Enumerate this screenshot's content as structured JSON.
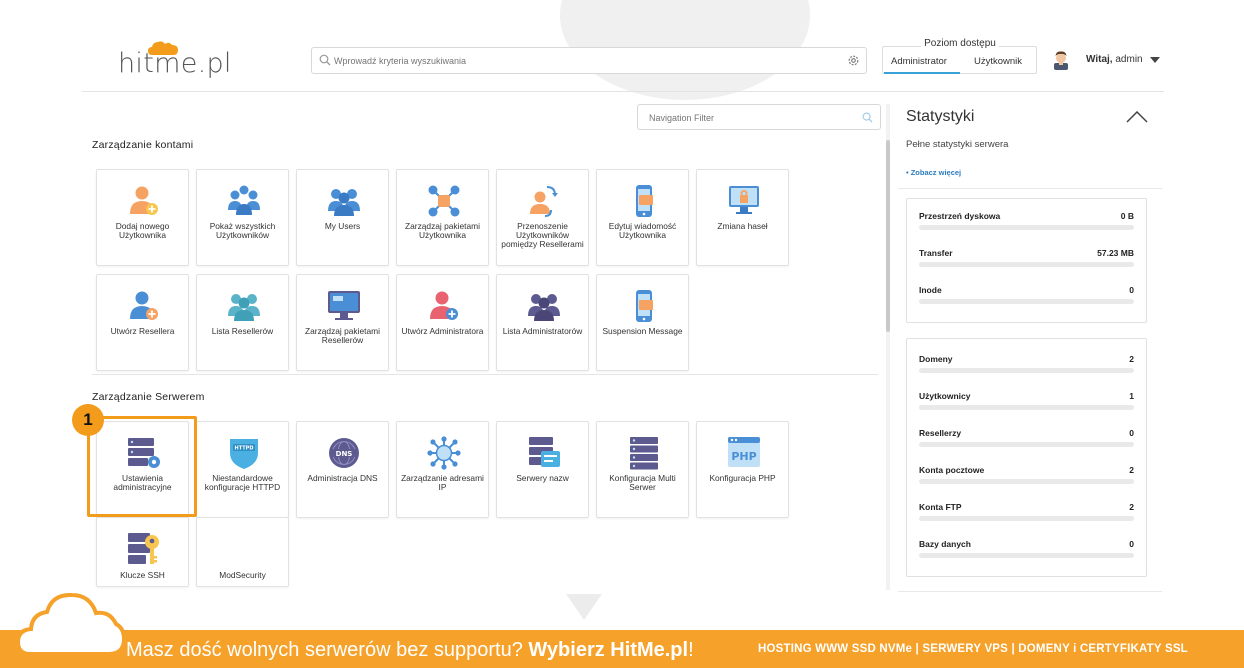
{
  "header": {
    "logo": "hitme.pl",
    "search_placeholder": "Wprowadź kryteria wyszukiwania",
    "access_label": "Poziom dostępu",
    "access_admin": "Administrator",
    "access_user": "Użytkownik",
    "greeting_bold": "Witaj,",
    "greeting_user": "admin"
  },
  "nav_filter_placeholder": "Navigation Filter",
  "sections": {
    "accounts_title": "Zarządzanie kontami",
    "server_title": "Zarządzanie Serwerem"
  },
  "tiles": {
    "add_user": "Dodaj nowego Użytkownika",
    "show_users": "Pokaż wszystkich Użytkowników",
    "my_users": "My Users",
    "manage_user_packages": "Zarządzaj pakietami Użytkownika",
    "move_users": "Przenoszenie Użytkowników pomiędzy Resellerami",
    "edit_user_message": "Edytuj wiadomość Użytkownika",
    "change_passwords": "Zmiana haseł",
    "create_reseller": "Utwórz Resellera",
    "reseller_list": "Lista Resellerów",
    "manage_reseller_packages": "Zarządzaj pakietami Resellerów",
    "create_admin": "Utwórz Administratora",
    "admin_list": "Lista Administratorów",
    "suspension_message": "Suspension Message",
    "admin_settings": "Ustawienia administracyjne",
    "custom_httpd": "Niestandardowe konfiguracje HTTPD",
    "dns_admin": "Administracja DNS",
    "ip_management": "Zarządzanie adresami IP",
    "name_servers": "Serwery nazw",
    "multi_server": "Konfiguracja Multi Serwer",
    "php_config": "Konfiguracja PHP",
    "ssh_keys": "Klucze SSH",
    "modsecurity": "ModSecurity",
    "httpd_icon_text": "HTTPD",
    "dns_icon_text": "DNS",
    "php_icon_text": "PHP"
  },
  "annotation_badge": "1",
  "stats": {
    "title": "Statystyki",
    "subtitle": "Pełne statystyki serwera",
    "more_link": "• Zobacz więcej",
    "card1": [
      {
        "label": "Przestrzeń dyskowa",
        "value": "0 B"
      },
      {
        "label": "Transfer",
        "value": "57.23 MB"
      },
      {
        "label": "Inode",
        "value": "0"
      }
    ],
    "card2": [
      {
        "label": "Domeny",
        "value": "2"
      },
      {
        "label": "Użytkownicy",
        "value": "1"
      },
      {
        "label": "Resellerzy",
        "value": "0"
      },
      {
        "label": "Konta pocztowe",
        "value": "2"
      },
      {
        "label": "Konta FTP",
        "value": "2"
      },
      {
        "label": "Bazy danych",
        "value": "0"
      }
    ]
  },
  "banner": {
    "text": "Masz dość wolnych serwerów bez supportu? ",
    "brand": "Wybierz HitMe.pl",
    "exclaim": "!",
    "right": "HOSTING WWW SSD NVMe | SERWERY VPS | DOMENY i CERTYFIKATY SSL"
  },
  "colors": {
    "accent_orange": "#f39c1c",
    "banner_orange": "#f5a12a",
    "icon_blue": "#4a8fd6",
    "icon_orange": "#f5a262",
    "icon_purple": "#5d5a8f",
    "link_blue": "#2b7cc0"
  }
}
